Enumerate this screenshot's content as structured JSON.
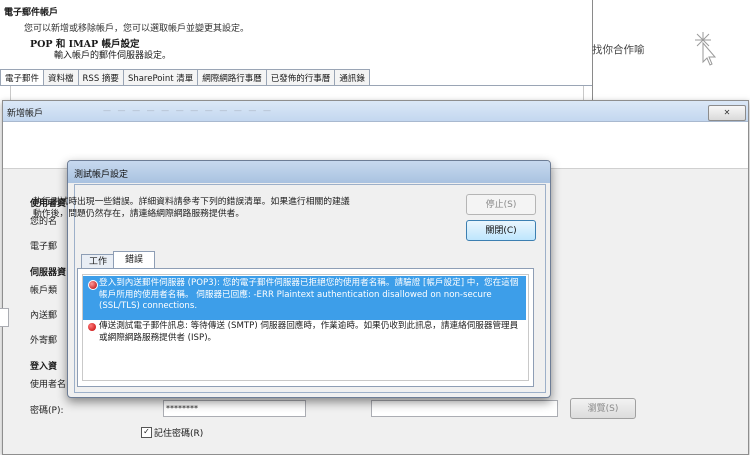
{
  "background_window": {
    "title": "電子郵件帳戶",
    "description": "您可以新增或移除帳戶，您可以選取帳戶並變更其設定。",
    "tabs": [
      "電子郵件",
      "資料檔",
      "RSS 摘要",
      "SharePoint 清單",
      "網際網路行事曆",
      "已發佈的行事曆",
      "通訊錄"
    ],
    "right_text": "找你合作喻"
  },
  "new_account": {
    "title": "新增帳戶",
    "close_label": "✕",
    "heading": "POP 和 IMAP 帳戶設定",
    "subheading": "輸入帳戶的郵件伺服器設定。",
    "labels": {
      "user_info": "使用者資",
      "your_name": "您的名",
      "email": "電子郵",
      "server_info": "伺服器資",
      "account_type": "帳戶類",
      "incoming": "內送郵",
      "outgoing": "外寄郵",
      "logon_info": "登入資",
      "username": "使用者名",
      "password": "密碼(P):"
    },
    "password_value": "********",
    "browse_label": "瀏覽(S)",
    "remember_password_label": "記住密碼(R)",
    "remember_password_checked": "✓"
  },
  "test_dialog": {
    "title": "測試帳戶設定",
    "message_line1": "執行測試時出現一些錯誤。詳細資料請參考下列的錯誤清單。如果進行相關的建議",
    "message_line2": "動作後，問題仍然存在，請連絡網際網路服務提供者。",
    "stop_label": "停止(S)",
    "close_label": "關閉(C)",
    "tabs": [
      "工作",
      "錯誤"
    ],
    "errors": [
      {
        "text": "登入到內送郵件伺服器 (POP3): 您的電子郵件伺服器已拒絕您的使用者名稱。請驗證 [帳戶設定] 中，您在這個帳戶所用的使用者名稱。 伺服器已回應: -ERR Plaintext authentication disallowed on non-secure (SSL/TLS) connections.",
        "selected": true
      },
      {
        "text": "傳送測試電子郵件訊息: 等待傳送 (SMTP) 伺服器回應時，作業逾時。如果仍收到此訊息，請連絡伺服器管理員或網際網路服務提供者 (ISP)。",
        "selected": false
      }
    ]
  }
}
